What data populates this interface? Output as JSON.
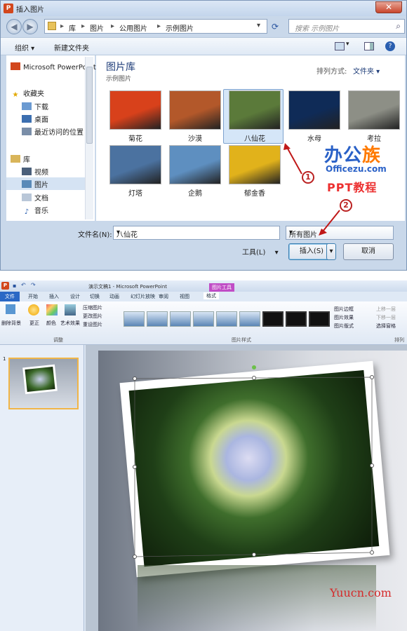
{
  "dialog": {
    "title": "插入图片",
    "close": "✕",
    "breadcrumb": [
      "库",
      "图片",
      "公用图片",
      "示例图片"
    ],
    "search_placeholder": "搜索 示例图片",
    "toolbar": {
      "organize": "组织 ▾",
      "new_folder": "新建文件夹"
    },
    "nav": {
      "top_item": "Microsoft PowerPoint",
      "favorites": "收藏夹",
      "fav_items": [
        "下载",
        "桌面",
        "最近访问的位置"
      ],
      "libraries": "库",
      "lib_items": [
        "视频",
        "图片",
        "文档",
        "音乐"
      ]
    },
    "library_title": "图片库",
    "library_sub": "示例图片",
    "arrange_label": "排列方式:",
    "arrange_value": "文件夹 ▾",
    "images": [
      {
        "name": "菊花",
        "color": "#d8411b"
      },
      {
        "name": "沙漠",
        "color": "#b3582a"
      },
      {
        "name": "八仙花",
        "color": "#5b7a3a"
      },
      {
        "name": "水母",
        "color": "#0f2b57"
      },
      {
        "name": "考拉",
        "color": "#8d8f86"
      },
      {
        "name": "灯塔",
        "color": "#4b72a0"
      },
      {
        "name": "企鹅",
        "color": "#5e8fc0"
      },
      {
        "name": "郁金香",
        "color": "#e1b21b"
      }
    ],
    "filename_label": "文件名(N):",
    "filename_value": "八仙花",
    "filetype_value": "所有图片",
    "tools_label": "工具(L)",
    "insert_label": "插入(S)",
    "cancel_label": "取消"
  },
  "watermark": {
    "brand_a": "办公",
    "brand_b": "族",
    "domain": "Officezu.com",
    "course": "PPT教程",
    "site": "Yuucn.com"
  },
  "callouts": [
    "1",
    "2"
  ],
  "ppt": {
    "title": "演示文稿1 - Microsoft PowerPoint",
    "picture_tools": "图片工具",
    "file_tab": "文件",
    "tabs": [
      "开始",
      "插入",
      "设计",
      "切换",
      "动画",
      "幻灯片放映",
      "审阅",
      "视图",
      "格式"
    ],
    "ribbon": {
      "remove_bg": "删除背景",
      "corrections": "更正",
      "color": "颜色",
      "artistic": "艺术效果",
      "compress": "压缩图片",
      "change": "更改图片",
      "reset": "重设图片",
      "adjust_group": "调整",
      "styles_group": "图片样式",
      "border": "图片边框",
      "effects": "图片效果",
      "layout": "图片版式",
      "bring_forward": "上移一层",
      "send_backward": "下移一层",
      "selection_pane": "选择窗格",
      "arrange_group": "排列"
    },
    "slide_number": "1"
  }
}
